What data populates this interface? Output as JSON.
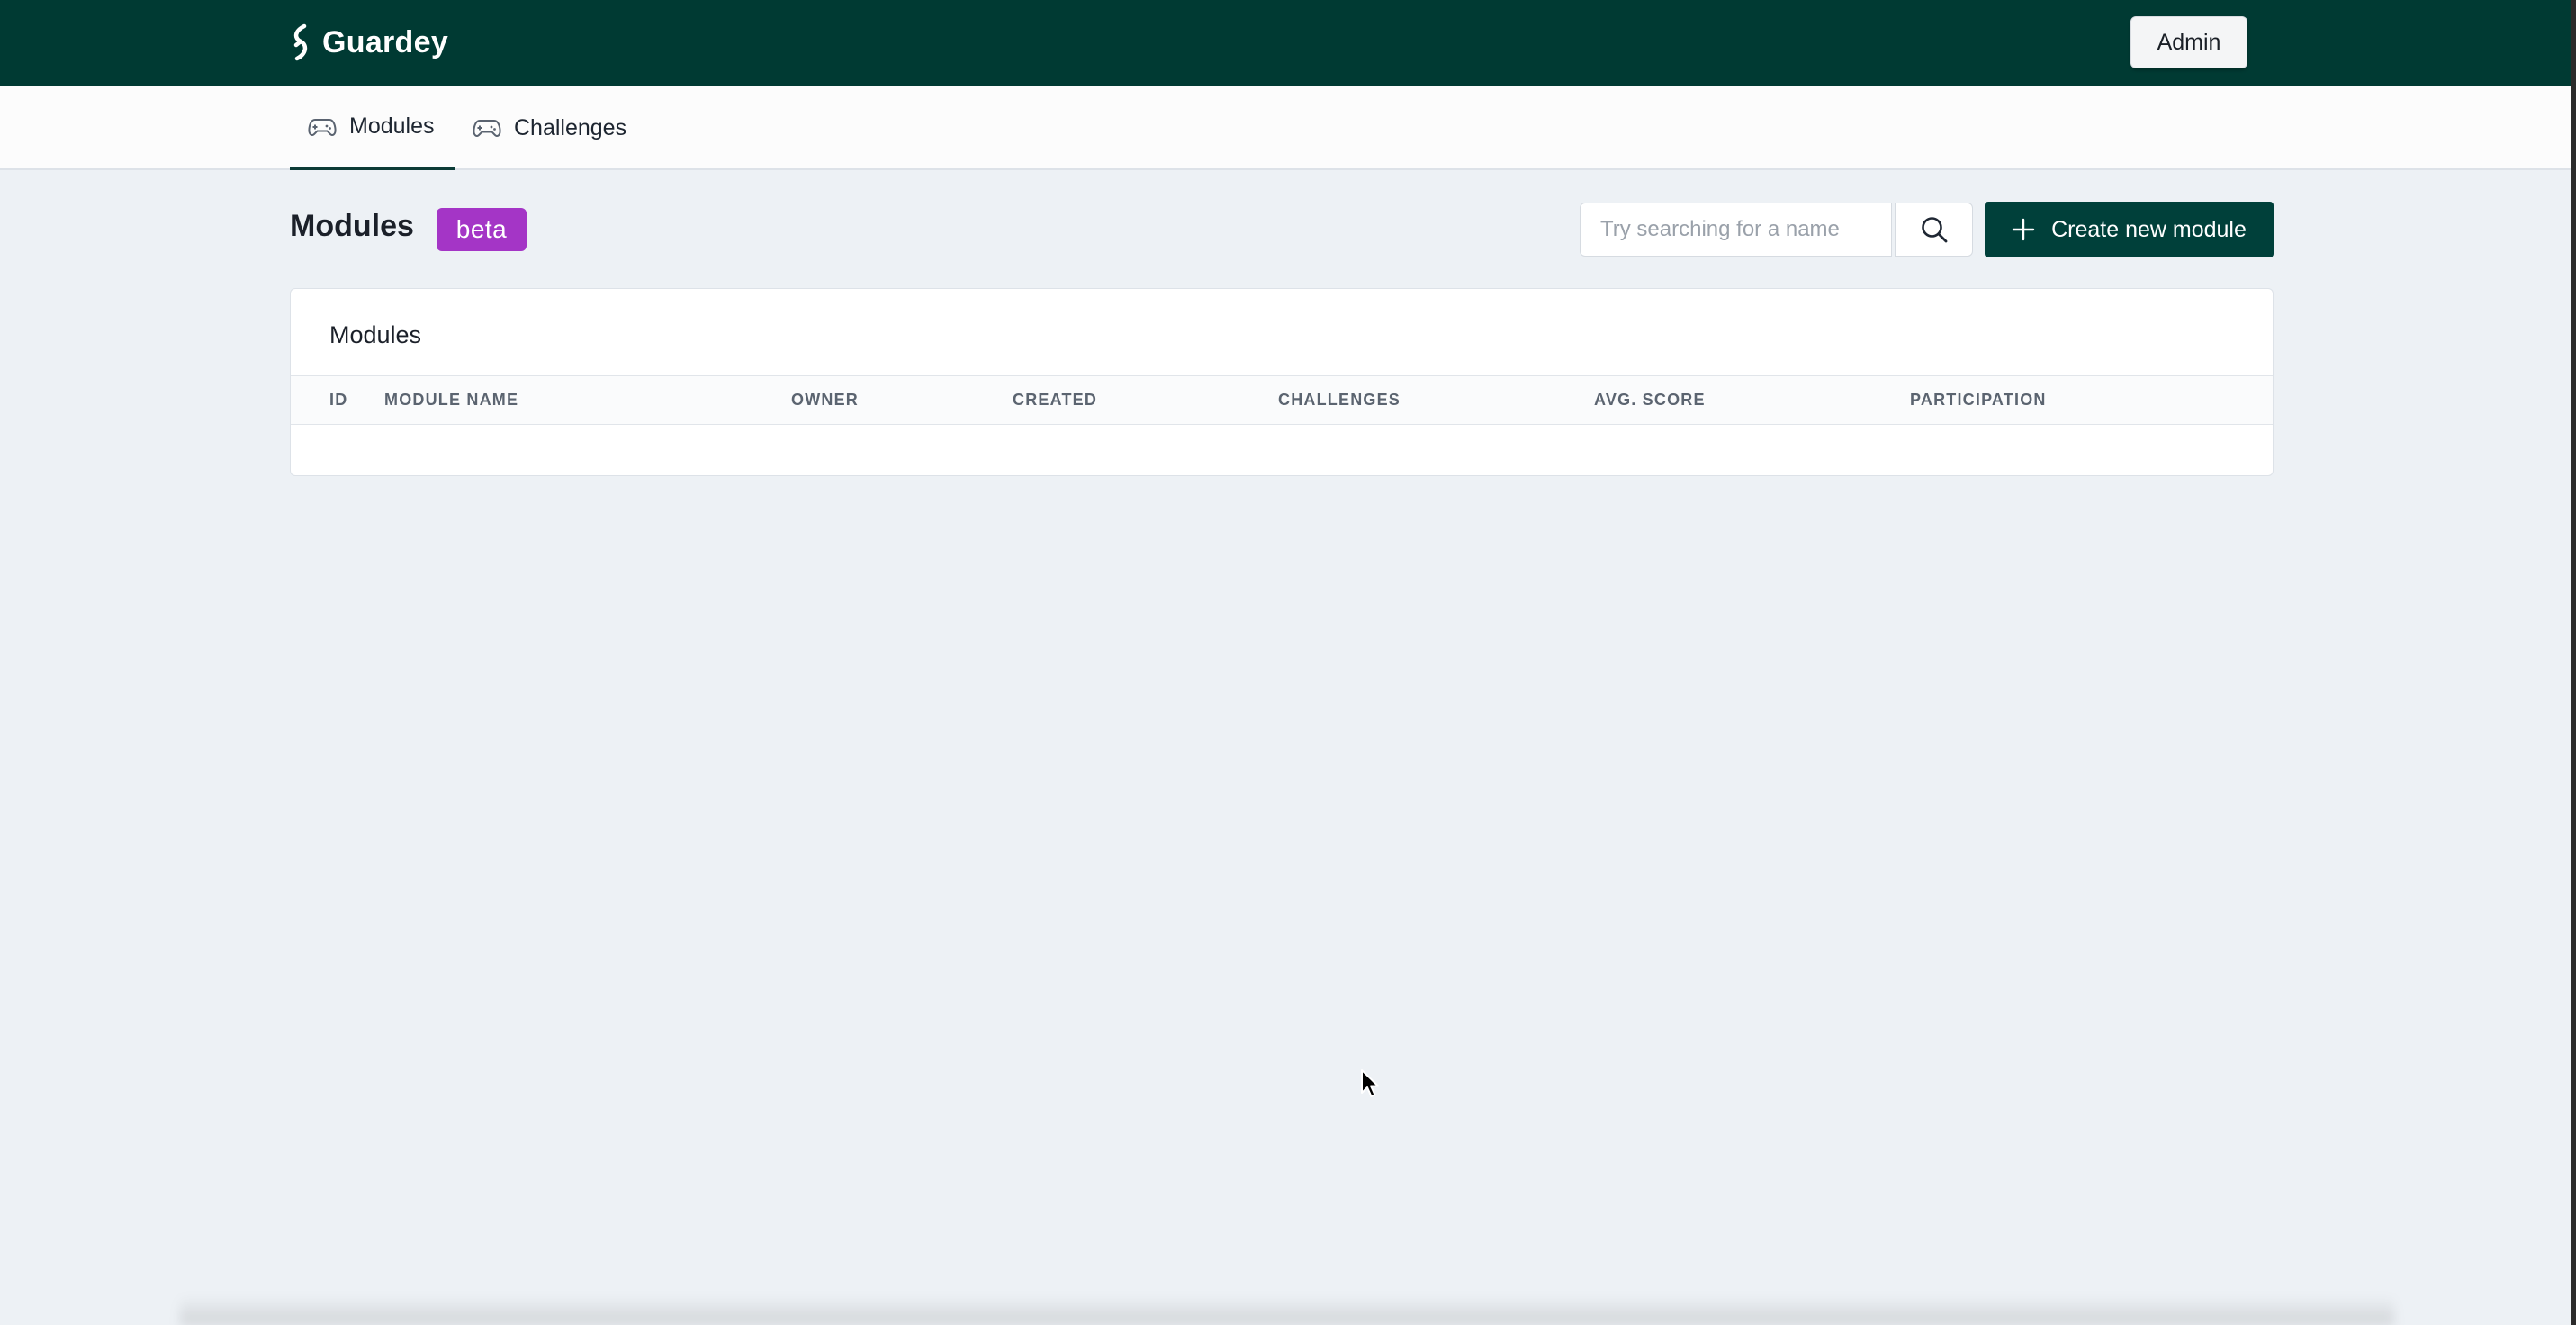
{
  "app": {
    "name": "Guardey",
    "admin_label": "Admin"
  },
  "nav": {
    "tabs": [
      {
        "label": "Modules",
        "icon": "gamepad-icon",
        "active": true
      },
      {
        "label": "Challenges",
        "icon": "gamepad-icon",
        "active": false
      }
    ]
  },
  "page": {
    "title": "Modules",
    "badge": "beta"
  },
  "search": {
    "value": "",
    "placeholder": "Try searching for a name"
  },
  "actions": {
    "create_label": "Create new module"
  },
  "table": {
    "title": "Modules",
    "columns": [
      "ID",
      "MODULE NAME",
      "OWNER",
      "CREATED",
      "CHALLENGES",
      "AVG. SCORE",
      "PARTICIPATION"
    ],
    "rows": []
  },
  "colors": {
    "brand_dark": "#003a33",
    "badge": "#a435c6",
    "background": "#edf1f5"
  }
}
